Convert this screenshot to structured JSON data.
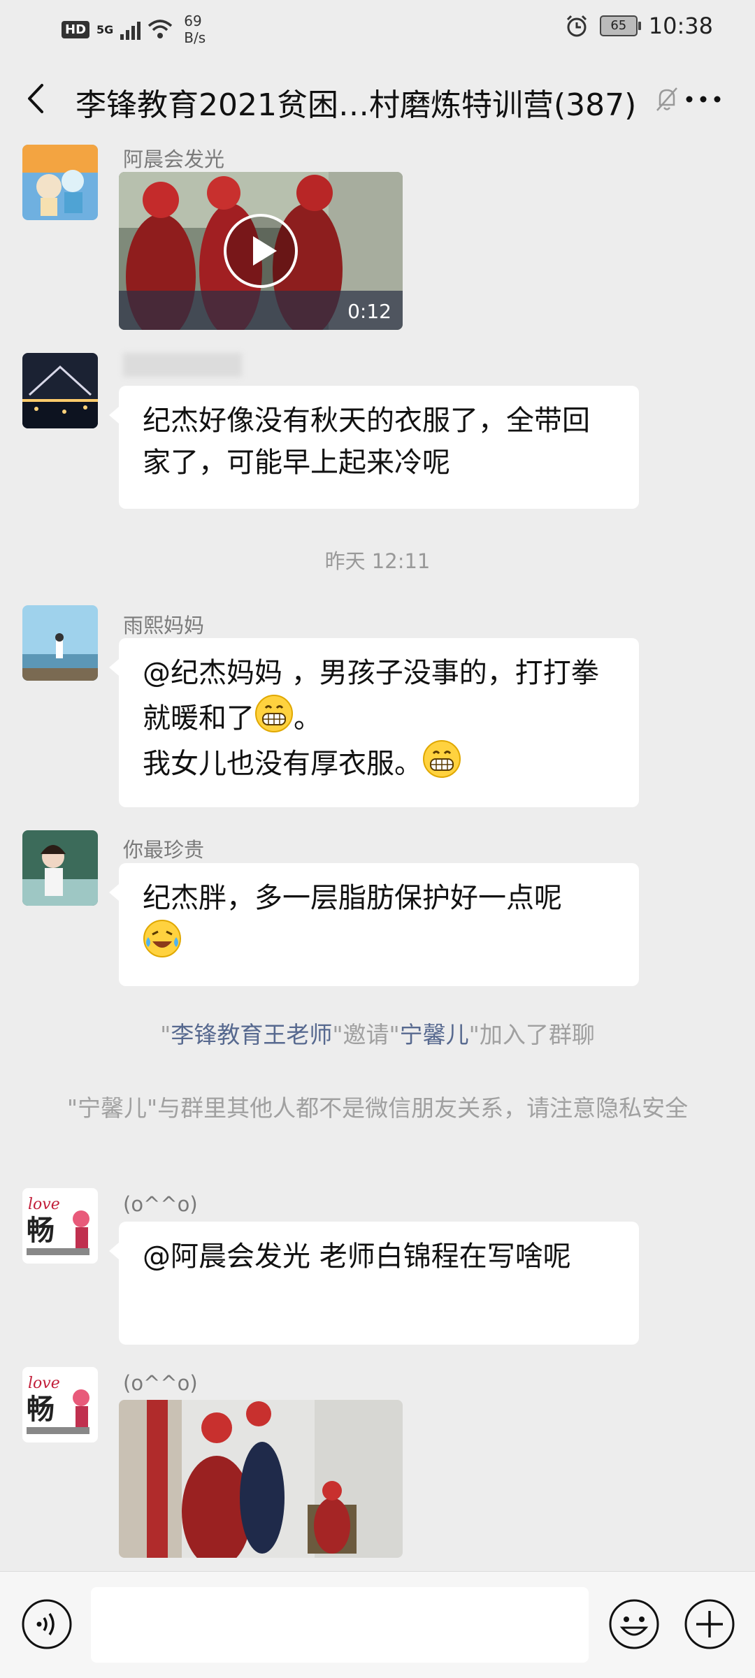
{
  "status_bar": {
    "hd": "HD",
    "network": "5G",
    "speed_value": "69",
    "speed_unit": "B/s",
    "battery": "65",
    "time": "10:38"
  },
  "header": {
    "title": "李锋教育2021贫困…村磨炼特训营(387)"
  },
  "messages": [
    {
      "sender": "阿晨会发光",
      "type": "video",
      "duration": "0:12"
    },
    {
      "sender": "",
      "type": "text",
      "text": "纪杰好像没有秋天的衣服了，全带回家了，可能早上起来冷呢"
    },
    {
      "type": "time",
      "text": "昨天 12:11"
    },
    {
      "sender": "雨熙妈妈",
      "type": "text",
      "parts": [
        "@纪杰妈妈 ，男孩子没事的，打打拳就暖和了",
        "。",
        "我女儿也没有厚衣服。"
      ]
    },
    {
      "sender": "你最珍贵",
      "type": "text",
      "text": "纪杰胖，多一层脂肪保护好一点呢"
    },
    {
      "type": "system",
      "parts": [
        "\"",
        "李锋教育王老师",
        "\"邀请\"",
        "宁馨儿",
        "\"加入了群聊"
      ]
    },
    {
      "type": "system",
      "text": "\"宁馨儿\"与群里其他人都不是微信朋友关系，请注意隐私安全"
    },
    {
      "sender": "(o^^o)",
      "type": "text",
      "text": "@阿晨会发光  老师白锦程在写啥呢"
    },
    {
      "sender": "(o^^o)",
      "type": "image"
    }
  ],
  "icons": {
    "grin": "grinning-emoji",
    "cry": "crying-laughing-emoji"
  },
  "colors": {
    "background": "#ededed",
    "bubble": "#ffffff",
    "link": "#57698f"
  }
}
